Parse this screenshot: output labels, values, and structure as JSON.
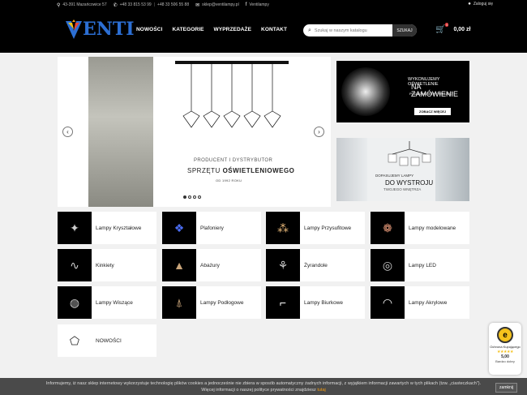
{
  "topbar": {
    "address": "43-391 Mazańcowice 57",
    "phone1": "+48 33 815 53 99",
    "phone2": "+48 33 506 55 88",
    "email": "sklep@ventilampy.pl",
    "social": "Ventilampy",
    "login": "Zaloguj się"
  },
  "header": {
    "logo_text": "ENTI",
    "nav": [
      "NOWOŚCI",
      "KATEGORIE",
      "WYPRZEDAŻE",
      "KONTAKT"
    ],
    "search_placeholder": "Szukaj w naszym katalogu",
    "search_button": "SZUKAJ",
    "cart_count": "0",
    "cart_total": "0,00 zł"
  },
  "slider": {
    "line1": "PRODUCENT I DYSTRYBUTOR",
    "line2a": "SPRZĘTU ",
    "line2b": "OŚWIETLENIOWEGO",
    "line3": "OD 1992 ROKU",
    "active_slide": 1,
    "slides_count": 4
  },
  "banner1": {
    "line1": "WYKONUJEMY OŚWIETLENIE",
    "line2": "NA ZAMÓWIENIE",
    "line3": "POD KONKRETNY PROJEKT",
    "button": "ZOBACZ WIĘCEJ"
  },
  "banner2": {
    "line1": "DOPASUJEMY LAMPY",
    "line2": "DO WYSTROJU",
    "line3": "TWOJEGO WNĘTRZA"
  },
  "categories": [
    {
      "label": "Lampy Kryształowe",
      "icon": "crystal-lamp-icon"
    },
    {
      "label": "Plafoniery",
      "icon": "ceiling-light-icon"
    },
    {
      "label": "Lampy Przysufitowe",
      "icon": "flush-mount-icon"
    },
    {
      "label": "Lampy modelowane",
      "icon": "model-lamp-icon"
    },
    {
      "label": "Kinkiety",
      "icon": "wall-lamp-icon"
    },
    {
      "label": "Abażury",
      "icon": "lampshade-icon"
    },
    {
      "label": "Żyrandole",
      "icon": "chandelier-icon"
    },
    {
      "label": "Lampy LED",
      "icon": "led-lamp-icon"
    },
    {
      "label": "Lampy Wiszące",
      "icon": "pendant-lamp-icon"
    },
    {
      "label": "Lampy Podłogowe",
      "icon": "floor-lamp-icon"
    },
    {
      "label": "Lampy Biurkowe",
      "icon": "desk-lamp-icon"
    },
    {
      "label": "Lampy Akrylowe",
      "icon": "acrylic-lamp-icon"
    },
    {
      "label": "NOWOŚCI",
      "icon": "new-items-icon"
    }
  ],
  "cookie": {
    "text1": "Informujemy, iż nasz sklep internetowy wykorzystuje technologię plików cookies a jednocześnie nie zbiera w sposób automatyczny żadnych informacji, z wyjątkiem informacji zawartych w tych plikach (tzw. „ciasteczkach\").",
    "text2": "Więcej informacji o naszej polityce prywatności znajdziesz ",
    "link": "tutaj",
    "close": "zamknij"
  },
  "trust": {
    "title": "Ochrona Kupującego",
    "stars": "★★★★★",
    "score": "5,00",
    "rating": "Bardzo dobry"
  },
  "colors": {
    "accent": "#2c6fd4",
    "header_bg": "#000000",
    "page_bg": "#f1f1f1"
  }
}
